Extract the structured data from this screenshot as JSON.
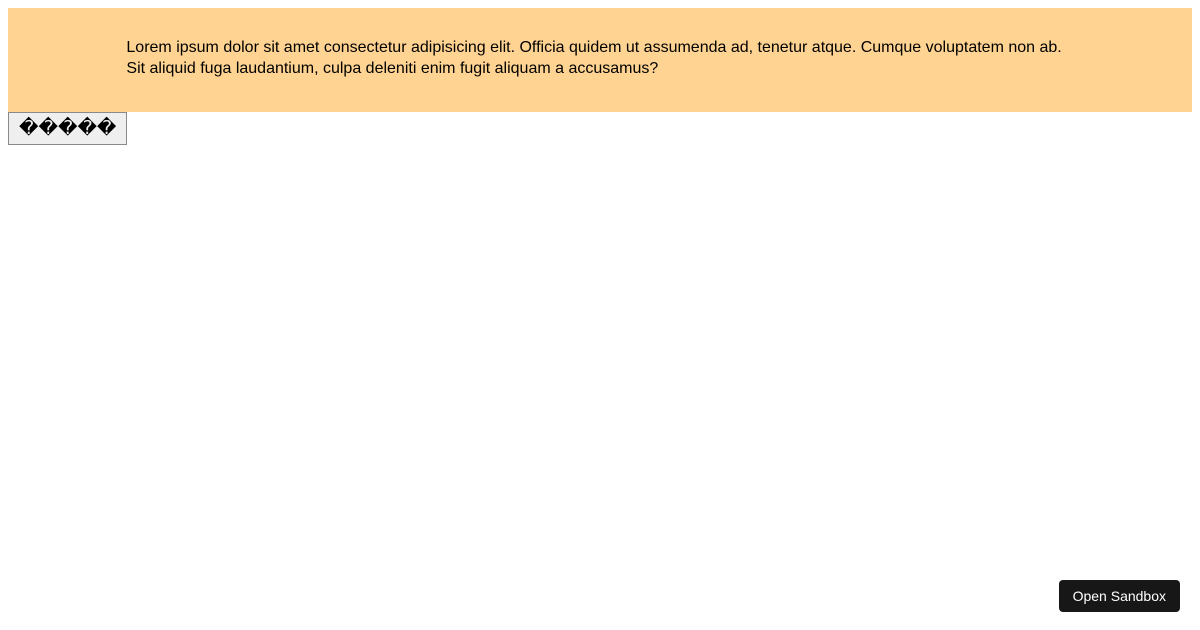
{
  "banner": {
    "text": "Lorem ipsum dolor sit amet consectetur adipisicing elit. Officia quidem ut assumenda ad, tenetur atque. Cumque voluptatem non ab. Sit aliquid fuga laudantium, culpa deleniti enim fugit aliquam a accusamus?"
  },
  "action_button": {
    "label": "�����"
  },
  "sandbox_button": {
    "label": "Open Sandbox"
  }
}
